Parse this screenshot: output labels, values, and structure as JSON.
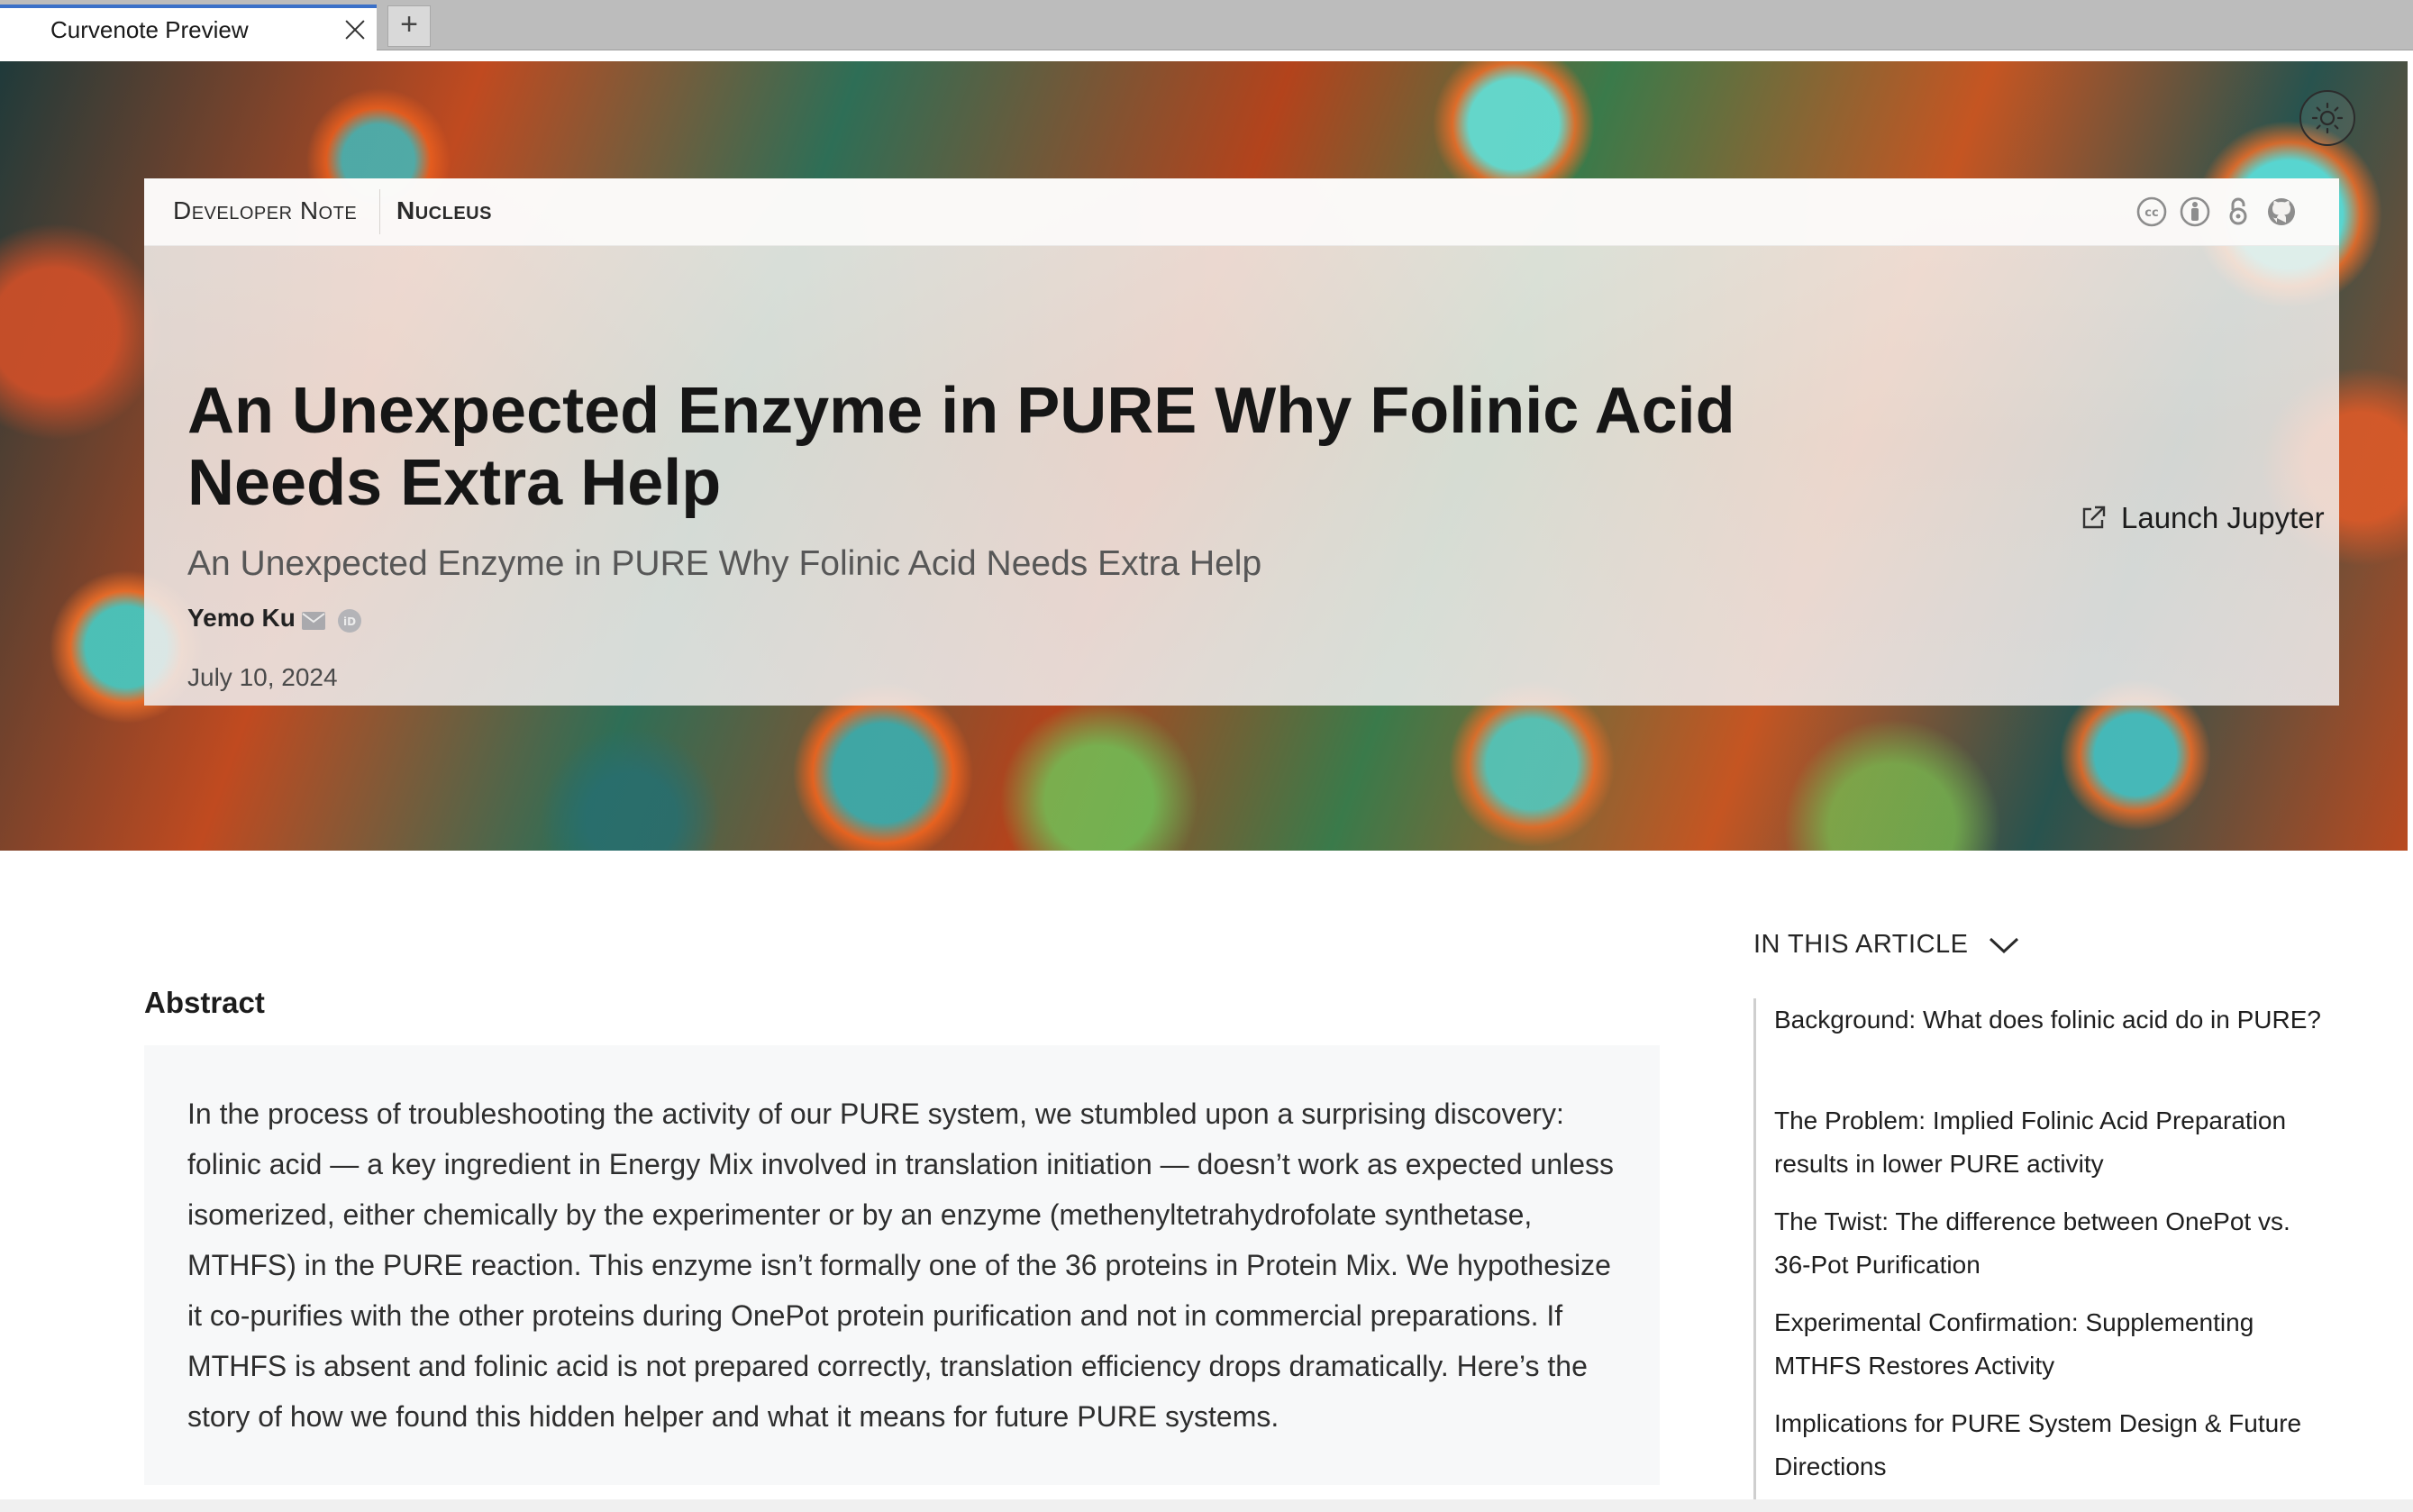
{
  "browser": {
    "tab_title": "Curvenote Preview",
    "new_tab_label": "+"
  },
  "header": {
    "kicker_primary": "Developer Note",
    "kicker_secondary": "Nucleus",
    "license_icons": [
      "cc-icon",
      "by-icon",
      "open-access-icon",
      "github-icon"
    ]
  },
  "article": {
    "title": "An Unexpected Enzyme in PURE Why Folinic Acid Needs Extra Help",
    "subtitle": "An Unexpected Enzyme in PURE Why Folinic Acid Needs Extra Help",
    "author": "Yemo Ku",
    "date": "July 10, 2024",
    "launch_label": "Launch Jupyter"
  },
  "abstract": {
    "heading": "Abstract",
    "text": "In the process of troubleshooting the activity of our PURE system, we stumbled upon a surprising discovery: folinic acid — a key ingredient in Energy Mix involved in translation initiation — doesn’t work as expected unless isomerized, either chemically by the experimenter or by an enzyme (methenyltetrahydrofolate synthetase, MTHFS) in the PURE reaction. This enzyme isn’t formally one of the 36 proteins in Protein Mix. We hypothesize it co-purifies with the other proteins during OnePot protein purification and not in commercial preparations. If MTHFS is absent and folinic acid is not prepared correctly, translation efficiency drops dramatically. Here’s the story of how we found this hidden helper and what it means for future PURE systems."
  },
  "toc": {
    "heading": "IN THIS ARTICLE",
    "items": [
      "Background: What does folinic acid do in PURE?",
      "The Problem: Implied Folinic Acid Preparation results in lower PURE activity",
      "The Twist: The difference between OnePot vs. 36-Pot Purification",
      "Experimental Confirmation: Supplementing MTHFS Restores Activity",
      "Implications for PURE System Design & Future Directions"
    ]
  },
  "colors": {
    "tab_accent": "#3a70c8",
    "title_text": "#161616",
    "subtitle_text": "#575757",
    "abstract_bg": "#f7f8f9",
    "toc_border": "#cfcfcf"
  }
}
